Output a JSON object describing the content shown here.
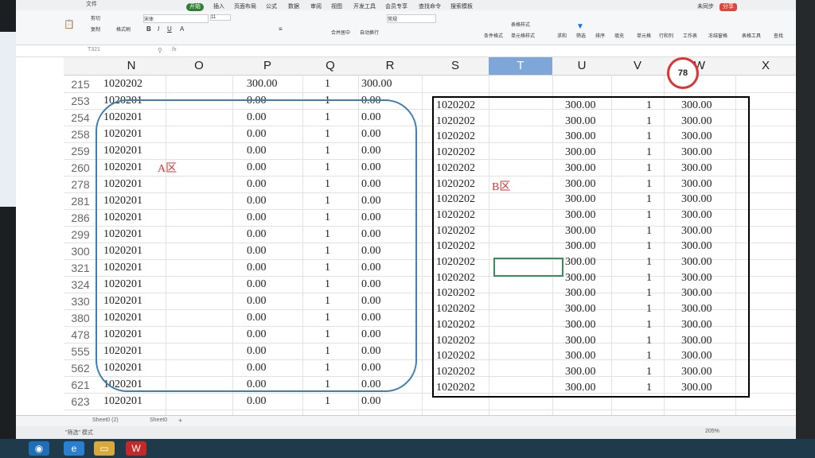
{
  "titlebar": {
    "menu_label": "文件"
  },
  "tabs": [
    "开始",
    "插入",
    "页面布局",
    "公式",
    "数据",
    "审阅",
    "视图",
    "开发工具",
    "会员专享",
    "查找命令",
    "搜索模板"
  ],
  "ribbon": {
    "cut": "剪切",
    "copy": "复制",
    "format_painter": "格式刷",
    "paste": "粘贴",
    "font_name": "宋体",
    "font_size": "11",
    "merge": "合并居中",
    "wrap": "自动换行",
    "number_format": "常规",
    "cond_format": "条件格式",
    "table_style": "表格样式",
    "cell_style": "单元格样式",
    "sum": "求和",
    "filter": "筛选",
    "sort": "排序",
    "fill": "填充",
    "cells": "单元格",
    "rowcol": "行和列",
    "sheet": "工作表",
    "freeze": "冻结窗格",
    "find": "查找",
    "tools": "表格工具",
    "collab": "未同步",
    "share": "分享"
  },
  "formula_bar": {
    "name_box": "T321",
    "fx": "fx",
    "content": ""
  },
  "columns": [
    "N",
    "O",
    "P",
    "Q",
    "R",
    "S",
    "T",
    "U",
    "V",
    "W",
    "X"
  ],
  "selected_column": "T",
  "zoom_badge": "78",
  "row_numbers": [
    "215",
    "253",
    "254",
    "258",
    "259",
    "260",
    "278",
    "281",
    "286",
    "299",
    "300",
    "321",
    "324",
    "330",
    "380",
    "478",
    "555",
    "562",
    "621",
    "623"
  ],
  "rows_left": [
    {
      "n": "1020202",
      "p": "300.00",
      "q": "1",
      "r": "300.00"
    },
    {
      "n": "1020201",
      "p": "0.00",
      "q": "1",
      "r": "0.00"
    },
    {
      "n": "1020201",
      "p": "0.00",
      "q": "1",
      "r": "0.00"
    },
    {
      "n": "1020201",
      "p": "0.00",
      "q": "1",
      "r": "0.00"
    },
    {
      "n": "1020201",
      "p": "0.00",
      "q": "1",
      "r": "0.00"
    },
    {
      "n": "1020201",
      "p": "0.00",
      "q": "1",
      "r": "0.00"
    },
    {
      "n": "1020201",
      "p": "0.00",
      "q": "1",
      "r": "0.00"
    },
    {
      "n": "1020201",
      "p": "0.00",
      "q": "1",
      "r": "0.00"
    },
    {
      "n": "1020201",
      "p": "0.00",
      "q": "1",
      "r": "0.00"
    },
    {
      "n": "1020201",
      "p": "0.00",
      "q": "1",
      "r": "0.00"
    },
    {
      "n": "1020201",
      "p": "0.00",
      "q": "1",
      "r": "0.00"
    },
    {
      "n": "1020201",
      "p": "0.00",
      "q": "1",
      "r": "0.00"
    },
    {
      "n": "1020201",
      "p": "0.00",
      "q": "1",
      "r": "0.00"
    },
    {
      "n": "1020201",
      "p": "0.00",
      "q": "1",
      "r": "0.00"
    },
    {
      "n": "1020201",
      "p": "0.00",
      "q": "1",
      "r": "0.00"
    },
    {
      "n": "1020201",
      "p": "0.00",
      "q": "1",
      "r": "0.00"
    },
    {
      "n": "1020201",
      "p": "0.00",
      "q": "1",
      "r": "0.00"
    },
    {
      "n": "1020201",
      "p": "0.00",
      "q": "1",
      "r": "0.00"
    },
    {
      "n": "1020201",
      "p": "0.00",
      "q": "1",
      "r": "0.00"
    },
    {
      "n": "1020201",
      "p": "0.00",
      "q": "1",
      "r": "0.00"
    }
  ],
  "rows_right": [
    {
      "s": "1020202",
      "u": "300.00",
      "v": "1",
      "w": "300.00"
    },
    {
      "s": "1020202",
      "u": "300.00",
      "v": "1",
      "w": "300.00"
    },
    {
      "s": "1020202",
      "u": "300.00",
      "v": "1",
      "w": "300.00"
    },
    {
      "s": "1020202",
      "u": "300.00",
      "v": "1",
      "w": "300.00"
    },
    {
      "s": "1020202",
      "u": "300.00",
      "v": "1",
      "w": "300.00"
    },
    {
      "s": "1020202",
      "u": "300.00",
      "v": "1",
      "w": "300.00"
    },
    {
      "s": "1020202",
      "u": "300.00",
      "v": "1",
      "w": "300.00"
    },
    {
      "s": "1020202",
      "u": "300.00",
      "v": "1",
      "w": "300.00"
    },
    {
      "s": "1020202",
      "u": "300.00",
      "v": "1",
      "w": "300.00"
    },
    {
      "s": "1020202",
      "u": "300.00",
      "v": "1",
      "w": "300.00"
    },
    {
      "s": "1020202",
      "u": "300.00",
      "v": "1",
      "w": "300.00"
    },
    {
      "s": "1020202",
      "u": "300.00",
      "v": "1",
      "w": "300.00"
    },
    {
      "s": "1020202",
      "u": "300.00",
      "v": "1",
      "w": "300.00"
    },
    {
      "s": "1020202",
      "u": "300.00",
      "v": "1",
      "w": "300.00"
    },
    {
      "s": "1020202",
      "u": "300.00",
      "v": "1",
      "w": "300.00"
    },
    {
      "s": "1020202",
      "u": "300.00",
      "v": "1",
      "w": "300.00"
    },
    {
      "s": "1020202",
      "u": "300.00",
      "v": "1",
      "w": "300.00"
    },
    {
      "s": "1020202",
      "u": "300.00",
      "v": "1",
      "w": "300.00"
    },
    {
      "s": "1020202",
      "u": "300.00",
      "v": "1",
      "w": "300.00"
    }
  ],
  "zone_labels": {
    "a": "A区",
    "b": "B区"
  },
  "sheets": [
    "Sheet0 (2)",
    "Sheet0"
  ],
  "add_sheet": "+",
  "status": {
    "mode": "\"筛选\" 模式",
    "zoom": "205%"
  },
  "colors": {
    "accent": "#2e7d32",
    "zone_a": "#3d7fb0",
    "zone_b": "#000000",
    "label": "#dd3333"
  }
}
